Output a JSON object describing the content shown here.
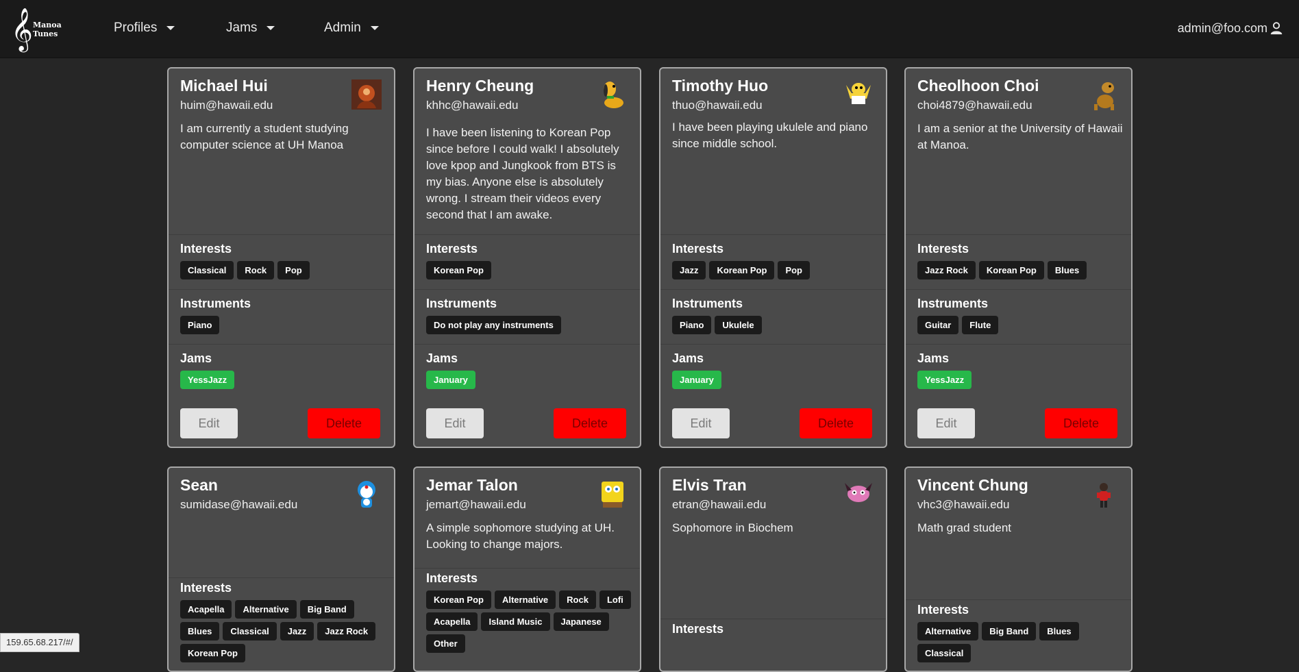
{
  "nav": {
    "brand_line1": "Manoa",
    "brand_line2": "Tunes",
    "items": [
      {
        "label": "Profiles"
      },
      {
        "label": "Jams"
      },
      {
        "label": "Admin"
      }
    ],
    "user": "admin@foo.com"
  },
  "labels": {
    "interests": "Interests",
    "instruments": "Instruments",
    "jams": "Jams",
    "edit": "Edit",
    "delete": "Delete"
  },
  "cards": [
    {
      "name": "Michael Hui",
      "email": "huim@hawaii.edu",
      "avatar": "fire-portrait-avatar",
      "bio": "I am currently a student studying computer science at UH Manoa",
      "interests": [
        "Classical",
        "Rock",
        "Pop"
      ],
      "instruments": [
        "Piano"
      ],
      "jams": [
        "YessJazz"
      ]
    },
    {
      "name": "Henry Cheung",
      "email": "khhc@hawaii.edu",
      "avatar": "pluto-dog-avatar",
      "bio": "I have been listening to Korean Pop since before I could walk! I absolutely love kpop and Jungkook from BTS is my bias. Anyone else is absolutely wrong. I stream their videos every second that I am awake.",
      "interests": [
        "Korean Pop"
      ],
      "instruments": [
        "Do not play any instruments"
      ],
      "jams": [
        "January"
      ]
    },
    {
      "name": "Timothy Huo",
      "email": "thuo@hawaii.edu",
      "avatar": "cartoon-man-avatar",
      "bio": "I have been playing ukulele and piano since middle school.",
      "interests": [
        "Jazz",
        "Korean Pop",
        "Pop"
      ],
      "instruments": [
        "Piano",
        "Ukulele"
      ],
      "jams": [
        "January"
      ]
    },
    {
      "name": "Cheolhoon Choi",
      "email": "choi4879@hawaii.edu",
      "avatar": "scooby-dog-avatar",
      "bio": "I am a senior at the University of Hawaii at Manoa.",
      "interests": [
        "Jazz Rock",
        "Korean Pop",
        "Blues"
      ],
      "instruments": [
        "Guitar",
        "Flute"
      ],
      "jams": [
        "YessJazz"
      ]
    },
    {
      "name": "Sean",
      "email": "sumidase@hawaii.edu",
      "avatar": "doraemon-avatar",
      "bio": "",
      "interests": [
        "Acapella",
        "Alternative",
        "Big Band",
        "Blues",
        "Classical",
        "Jazz",
        "Jazz Rock",
        "Korean Pop"
      ]
    },
    {
      "name": "Jemar Talon",
      "email": "jemart@hawaii.edu",
      "avatar": "spongebob-avatar",
      "bio": "A simple sophomore studying at UH. Looking to change majors.",
      "interests": [
        "Korean Pop",
        "Alternative",
        "Rock",
        "Lofi",
        "Acapella",
        "Island Music",
        "Japanese",
        "Other"
      ]
    },
    {
      "name": "Elvis Tran",
      "email": "etran@hawaii.edu",
      "avatar": "courage-dog-avatar",
      "bio": "Sophomore in Biochem",
      "interests": []
    },
    {
      "name": "Vincent Chung",
      "email": "vhc3@hawaii.edu",
      "avatar": "superhero-kid-avatar",
      "bio": "Math grad student",
      "interests": [
        "Alternative",
        "Big Band",
        "Blues",
        "Classical"
      ]
    }
  ],
  "status_url": "159.65.68.217/#/"
}
